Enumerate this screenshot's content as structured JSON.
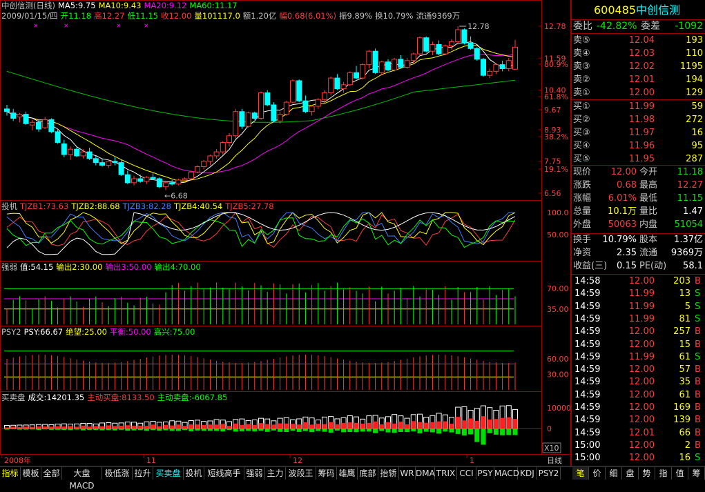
{
  "stock": {
    "code": "600485",
    "name": "中创信测"
  },
  "main": {
    "title": "中创信测(日线)",
    "ma": [
      {
        "label": "MA5:9.75",
        "color": "#ffffff"
      },
      {
        "label": "MA10:9.43",
        "color": "#ffff00"
      },
      {
        "label": "MA20:9.12",
        "color": "#ff00ff"
      },
      {
        "label": "MA60:11.17",
        "color": "#00ff00"
      }
    ],
    "info": [
      {
        "text": "2009/01/15/四",
        "color": "#c0c0c0"
      },
      {
        "text": "开11.18",
        "color": "#00ff00"
      },
      {
        "text": "高12.27",
        "color": "#ff3c3c"
      },
      {
        "text": "低11.15",
        "color": "#00ff00"
      },
      {
        "text": "收12.00",
        "color": "#ff3c3c"
      },
      {
        "text": "量101117.0",
        "color": "#ffff00"
      },
      {
        "text": "额1.20亿",
        "color": "#c0c0c0"
      },
      {
        "text": "幅0.68(6.01%)",
        "color": "#ff3c3c"
      },
      {
        "text": "振9.89%",
        "color": "#c0c0c0"
      },
      {
        "text": "换10.79%",
        "color": "#c0c0c0"
      },
      {
        "text": "流通9369万",
        "color": "#c0c0c0"
      }
    ],
    "high_label": "12.78",
    "low_label": "6.68",
    "axis": [
      "12.78",
      "11.59",
      "80.9%",
      "10.40",
      "61.8%",
      "9.67",
      "8.93",
      "38.2%",
      "7.75",
      "19.1%",
      "6.56"
    ]
  },
  "ind1": {
    "name": "投机",
    "labels": [
      {
        "text": "TJZB1:73.63",
        "color": "#ff3c3c"
      },
      {
        "text": "TJZB2:88.68",
        "color": "#ffff00"
      },
      {
        "text": "TJZB3:82.28",
        "color": "#4080ff"
      },
      {
        "text": "TJZB4:40.54",
        "color": "#ffff00"
      },
      {
        "text": "TJZB5:27.78",
        "color": "#ff3c3c"
      }
    ],
    "axis": [
      "100.0",
      "50.00"
    ]
  },
  "ind2": {
    "name": "强弱",
    "labels": [
      {
        "text": "值:54.15",
        "color": "#ffffff"
      },
      {
        "text": "输出2:30.00",
        "color": "#ffff00"
      },
      {
        "text": "输出3:50.00",
        "color": "#ff00ff"
      },
      {
        "text": "输出4:70.00",
        "color": "#00ff00"
      }
    ],
    "axis": [
      "70.00",
      "35.00"
    ]
  },
  "ind3": {
    "name": "PSY2",
    "labels": [
      {
        "text": "PSY:66.67",
        "color": "#ffffff"
      },
      {
        "text": "绝望:25.00",
        "color": "#ffff00"
      },
      {
        "text": "平衡:50.00",
        "color": "#ff00ff"
      },
      {
        "text": "高兴:75.00",
        "color": "#00ff00"
      }
    ],
    "axis": [
      "60.00",
      "30.00"
    ]
  },
  "ind4": {
    "name": "买卖盘",
    "labels": [
      {
        "text": "成交:14201.35",
        "color": "#ffffff"
      },
      {
        "text": "主动买盘:8133.50",
        "color": "#ff3c3c"
      },
      {
        "text": "主动卖盘:-6067.85",
        "color": "#00ff00"
      }
    ],
    "axis": [
      "10000",
      "0"
    ],
    "multiplier": "X10"
  },
  "xaxis": {
    "labels": [
      "2008年",
      "11",
      "12",
      "1"
    ],
    "period": "日线"
  },
  "order_book": {
    "webi_label": "委比",
    "webi_value": "-42.82%",
    "weicha_label": "委差",
    "weicha_value": "-1092",
    "sells": [
      {
        "label": "卖⑤",
        "price": "12.04",
        "vol": "193"
      },
      {
        "label": "卖④",
        "price": "12.03",
        "vol": "110"
      },
      {
        "label": "卖③",
        "price": "12.02",
        "vol": "1195"
      },
      {
        "label": "卖②",
        "price": "12.01",
        "vol": "194"
      },
      {
        "label": "卖①",
        "price": "12.00",
        "vol": "129"
      }
    ],
    "buys": [
      {
        "label": "买①",
        "price": "11.99",
        "vol": "59"
      },
      {
        "label": "买②",
        "price": "11.98",
        "vol": "272"
      },
      {
        "label": "买③",
        "price": "11.97",
        "vol": "16"
      },
      {
        "label": "买④",
        "price": "11.96",
        "vol": "95"
      },
      {
        "label": "买⑤",
        "price": "11.95",
        "vol": "287"
      }
    ]
  },
  "quote": {
    "rows": [
      {
        "l1": "现价",
        "v1": "12.00",
        "c1": "red",
        "l2": "今开",
        "v2": "11.18",
        "c2": "green"
      },
      {
        "l1": "涨跌",
        "v1": "0.68",
        "c1": "red",
        "l2": "最高",
        "v2": "12.27",
        "c2": "red"
      },
      {
        "l1": "涨幅",
        "v1": "6.01%",
        "c1": "red",
        "l2": "最低",
        "v2": "11.15",
        "c2": "green"
      },
      {
        "l1": "总量",
        "v1": "10.1万",
        "c1": "yellow",
        "l2": "量比",
        "v2": "1.47",
        "c2": "white"
      },
      {
        "l1": "外盘",
        "v1": "50063",
        "c1": "red",
        "l2": "内盘",
        "v2": "51054",
        "c2": "green"
      }
    ],
    "rows2": [
      {
        "l1": "换手",
        "v1": "10.79%",
        "l2": "股本",
        "v2": "1.37亿"
      },
      {
        "l1": "净资",
        "v1": "2.35",
        "l2": "流通",
        "v2": "9369万"
      },
      {
        "l1": "收益(三)",
        "v1": "0.15",
        "l2": "PE(动)",
        "v2": "58.1"
      }
    ]
  },
  "ticks": [
    {
      "time": "14:58",
      "price": "12.00",
      "pc": "red",
      "vol": "203",
      "side": "B"
    },
    {
      "time": "14:59",
      "price": "11.99",
      "pc": "red",
      "vol": "13",
      "side": "S"
    },
    {
      "time": "14:59",
      "price": "11.99",
      "pc": "red",
      "vol": "5",
      "side": "S"
    },
    {
      "time": "14:59",
      "price": "11.99",
      "pc": "red",
      "vol": "81",
      "side": "S"
    },
    {
      "time": "14:59",
      "price": "12.00",
      "pc": "red",
      "vol": "257",
      "side": "B"
    },
    {
      "time": "14:59",
      "price": "12.00",
      "pc": "red",
      "vol": "15",
      "side": "B"
    },
    {
      "time": "14:59",
      "price": "11.99",
      "pc": "red",
      "vol": "61",
      "side": "S"
    },
    {
      "time": "14:59",
      "price": "12.00",
      "pc": "red",
      "vol": "57",
      "side": "B"
    },
    {
      "time": "14:59",
      "price": "12.00",
      "pc": "red",
      "vol": "35",
      "side": "B"
    },
    {
      "time": "14:59",
      "price": "12.00",
      "pc": "red",
      "vol": "61",
      "side": "B"
    },
    {
      "time": "14:59",
      "price": "12.00",
      "pc": "red",
      "vol": "169",
      "side": "B"
    },
    {
      "time": "14:59",
      "price": "12.00",
      "pc": "red",
      "vol": "139",
      "side": "B"
    },
    {
      "time": "14:59",
      "price": "12.01",
      "pc": "red",
      "vol": "66",
      "side": "B"
    },
    {
      "time": "15:00",
      "price": "12.00",
      "pc": "red",
      "vol": "2",
      "side": "B"
    },
    {
      "time": "15:00",
      "price": "12.00",
      "pc": "red",
      "vol": "16",
      "side": "S"
    }
  ],
  "tabs": [
    "指标",
    "模板",
    "全部",
    "大盘MACD",
    "极低涨",
    "拉升",
    "买卖盘",
    "投机",
    "短线高手",
    "强弱",
    "主力",
    "波段王",
    "筹码",
    "雄鹰",
    "底部",
    "抬轿",
    "WR",
    "DMA",
    "TRIX",
    "CCI",
    "PSY",
    "MACD",
    "KDJ",
    "PSY2"
  ],
  "right_tabs": [
    "笔",
    "价",
    "细",
    "盘",
    "势",
    "指",
    "值",
    "筹"
  ],
  "colors": {
    "up": "#ff3c3c",
    "down": "#00ffff",
    "border": "#a00000"
  },
  "chart_data": {
    "type": "candlestick",
    "candles": [
      [
        9.7,
        9.85,
        9.45,
        9.6
      ],
      [
        9.55,
        9.7,
        9.25,
        9.35
      ],
      [
        9.4,
        9.55,
        9.2,
        9.5
      ],
      [
        9.5,
        9.6,
        9.1,
        9.15
      ],
      [
        9.1,
        9.3,
        8.9,
        9.2
      ],
      [
        9.2,
        9.3,
        8.85,
        8.95
      ],
      [
        9.0,
        9.4,
        8.95,
        9.3
      ],
      [
        9.3,
        9.35,
        8.8,
        8.85
      ],
      [
        8.85,
        8.95,
        8.4,
        8.45
      ],
      [
        8.4,
        8.55,
        7.9,
        8.0
      ],
      [
        8.0,
        8.3,
        7.8,
        8.2
      ],
      [
        8.2,
        8.3,
        7.9,
        7.95
      ],
      [
        7.95,
        8.2,
        7.85,
        8.1
      ],
      [
        8.1,
        8.25,
        7.8,
        7.85
      ],
      [
        7.85,
        7.95,
        7.6,
        7.7
      ],
      [
        7.7,
        7.85,
        7.55,
        7.6
      ],
      [
        7.6,
        7.8,
        7.5,
        7.75
      ],
      [
        7.75,
        7.9,
        7.6,
        7.7
      ],
      [
        7.7,
        7.8,
        7.2,
        7.25
      ],
      [
        7.25,
        7.4,
        6.9,
        6.95
      ],
      [
        6.95,
        7.2,
        6.85,
        7.1
      ],
      [
        7.1,
        7.25,
        6.95,
        7.0
      ],
      [
        7.0,
        7.2,
        6.9,
        7.15
      ],
      [
        7.15,
        7.3,
        7.05,
        7.1
      ],
      [
        7.1,
        7.15,
        6.75,
        6.8
      ],
      [
        6.8,
        7.0,
        6.68,
        6.95
      ],
      [
        6.95,
        7.05,
        6.85,
        6.9
      ],
      [
        6.9,
        7.1,
        6.85,
        7.05
      ],
      [
        7.05,
        7.15,
        6.95,
        7.1
      ],
      [
        7.1,
        7.4,
        7.05,
        7.35
      ],
      [
        7.35,
        7.6,
        7.3,
        7.55
      ],
      [
        7.55,
        7.8,
        7.45,
        7.75
      ],
      [
        7.75,
        8.0,
        7.6,
        7.95
      ],
      [
        7.95,
        8.2,
        7.85,
        8.1
      ],
      [
        8.1,
        8.5,
        8.0,
        8.45
      ],
      [
        8.45,
        8.8,
        8.3,
        8.7
      ],
      [
        8.7,
        9.7,
        8.6,
        9.6
      ],
      [
        9.6,
        9.7,
        8.95,
        9.05
      ],
      [
        9.05,
        9.6,
        9.0,
        9.55
      ],
      [
        9.55,
        9.6,
        9.3,
        9.35
      ],
      [
        9.35,
        10.35,
        9.3,
        10.3
      ],
      [
        10.3,
        10.4,
        9.8,
        9.85
      ],
      [
        9.85,
        9.95,
        9.2,
        9.25
      ],
      [
        9.25,
        9.6,
        9.15,
        9.5
      ],
      [
        9.5,
        10.0,
        9.45,
        9.95
      ],
      [
        9.95,
        10.8,
        9.9,
        10.75
      ],
      [
        10.75,
        10.8,
        9.95,
        10.0
      ],
      [
        10.0,
        10.2,
        9.55,
        9.6
      ],
      [
        9.6,
        9.85,
        9.45,
        9.8
      ],
      [
        9.8,
        10.1,
        9.7,
        10.05
      ],
      [
        10.05,
        10.4,
        9.95,
        10.3
      ],
      [
        10.3,
        10.9,
        10.2,
        10.85
      ],
      [
        10.85,
        11.0,
        10.4,
        10.45
      ],
      [
        10.45,
        10.7,
        10.3,
        10.6
      ],
      [
        10.6,
        11.1,
        10.55,
        11.05
      ],
      [
        11.05,
        11.3,
        10.8,
        10.85
      ],
      [
        10.85,
        11.4,
        10.8,
        11.35
      ],
      [
        11.35,
        11.9,
        11.2,
        11.85
      ],
      [
        11.85,
        11.95,
        11.0,
        11.05
      ],
      [
        11.05,
        11.5,
        10.95,
        11.45
      ],
      [
        11.45,
        11.55,
        11.1,
        11.15
      ],
      [
        11.15,
        11.6,
        11.1,
        11.55
      ],
      [
        11.55,
        11.7,
        11.2,
        11.25
      ],
      [
        11.25,
        11.6,
        11.2,
        11.5
      ],
      [
        11.5,
        11.8,
        11.4,
        11.75
      ],
      [
        11.75,
        12.4,
        11.7,
        12.35
      ],
      [
        12.35,
        12.4,
        11.8,
        11.85
      ],
      [
        11.85,
        12.2,
        11.7,
        12.1
      ],
      [
        12.1,
        12.25,
        11.7,
        11.75
      ],
      [
        11.75,
        12.1,
        11.7,
        12.05
      ],
      [
        12.05,
        12.3,
        11.9,
        12.2
      ],
      [
        12.2,
        12.78,
        12.1,
        12.65
      ],
      [
        12.65,
        12.7,
        12.1,
        12.15
      ],
      [
        12.15,
        12.4,
        11.9,
        11.95
      ],
      [
        11.95,
        12.0,
        11.5,
        11.55
      ],
      [
        11.55,
        11.6,
        10.9,
        10.95
      ],
      [
        10.95,
        11.2,
        10.85,
        11.1
      ],
      [
        11.1,
        11.4,
        11.0,
        11.35
      ],
      [
        11.35,
        11.5,
        11.1,
        11.2
      ],
      [
        11.2,
        11.6,
        11.1,
        11.5
      ],
      [
        11.18,
        12.27,
        11.15,
        12.0
      ]
    ]
  }
}
